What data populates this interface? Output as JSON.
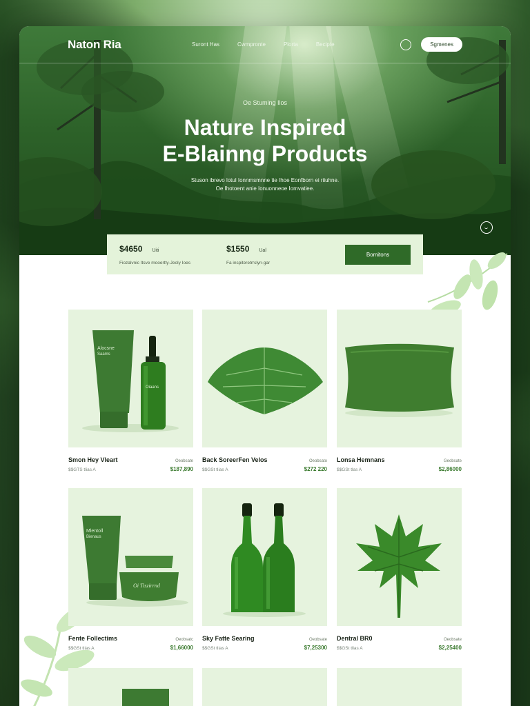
{
  "brand": "Naton Ria",
  "nav": {
    "links": [
      "Suront Has",
      "Cwmpronte",
      "Plorta",
      "Becipte"
    ],
    "cta": "Sgmenes"
  },
  "hero": {
    "eyebrow": "Oe Stuming Ilos",
    "title_line1": "Nature Inspired",
    "title_line2": "E-Blainng Products",
    "sub_line1": "Stuson ibrevo lotul Ionnmsmnne tie Ihoe Eonfborn ei riiuhne.",
    "sub_line2": "Oe Ihotoent anie Ionuonneoe Iomvatiee."
  },
  "pricing": {
    "a": {
      "price": "$4650",
      "tag": "Uiti",
      "note": "Fiozalvnic Itsve mooertty-Jeoly Ioes"
    },
    "b": {
      "price": "$1550",
      "tag": "Ual",
      "note": "Fa inspiteretrrslyn-gar"
    },
    "button": "Bomitons"
  },
  "products": [
    {
      "name": "Smon Hey Vleart",
      "category": "Oeobsate",
      "meta": "$$GTS tlias A",
      "price": "$187,890",
      "icon": "tube-and-dropper-bottle"
    },
    {
      "name": "Back SoreerFen Velos",
      "category": "Oeobsato",
      "meta": "$$GSt tlias A",
      "price": "$272 220",
      "icon": "large-green-leaf"
    },
    {
      "name": "Lonsa Hemnans",
      "category": "Geobsate",
      "meta": "$$GSt tlas A",
      "price": "$2,86000",
      "icon": "green-pillow"
    },
    {
      "name": "Fente Follectims",
      "category": "Oeobsatc",
      "meta": "$$GSt tlias A",
      "price": "$1,66000",
      "icon": "tube-and-cream-jar"
    },
    {
      "name": "Sky Fatte Searing",
      "category": "Oeobsate",
      "meta": "$$GSt tlias A",
      "price": "$7,25300",
      "icon": "two-green-bottles"
    },
    {
      "name": "Dentral BR0",
      "category": "Oeobsate",
      "meta": "$$GSt tlias A",
      "price": "$2,25400",
      "icon": "maple-leaf"
    }
  ],
  "cream_jar_label": "Oi Tiszirrnd",
  "colors": {
    "accent": "#2f6a28",
    "price": "#3a7a2e",
    "card_bg": "#e6f3de",
    "price_bar": "#e4f3da"
  }
}
